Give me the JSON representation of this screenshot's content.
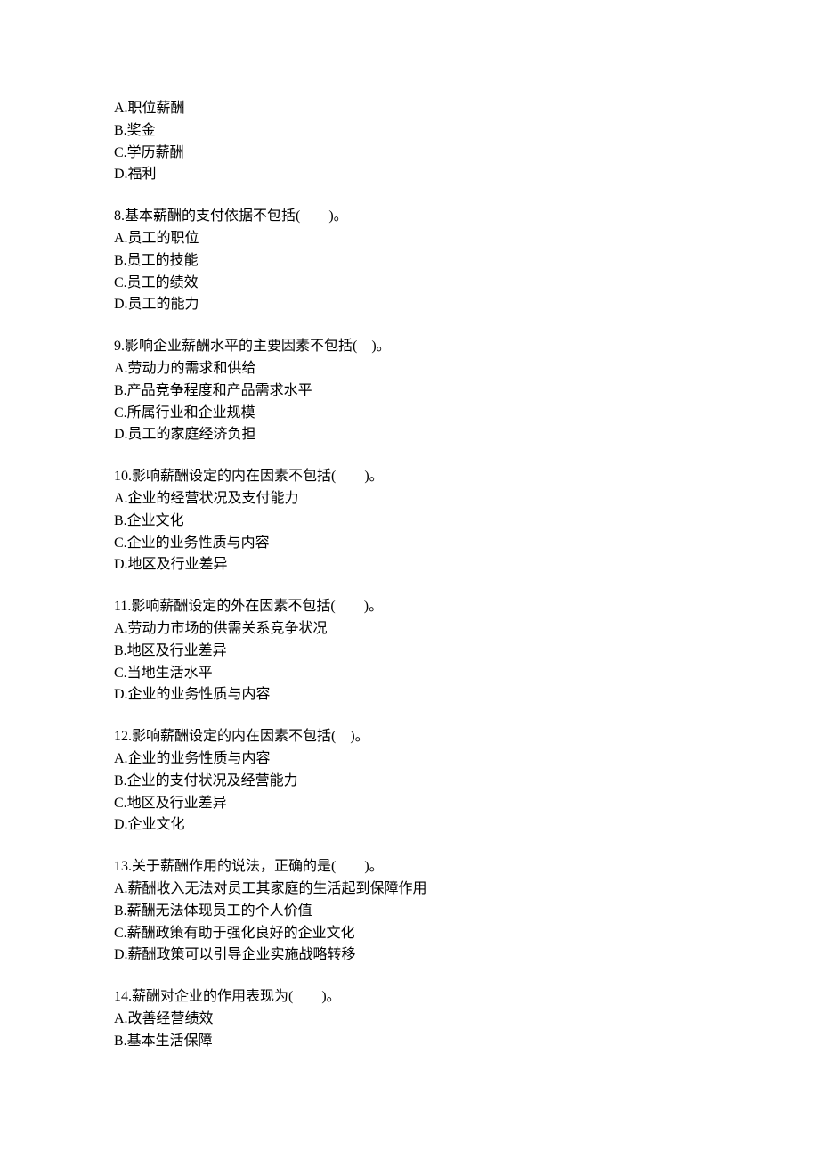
{
  "orphan_options": [
    "A.职位薪酬",
    "B.奖金",
    "C.学历薪酬",
    "D.福利"
  ],
  "questions": [
    {
      "stem": "8.基本薪酬的支付依据不包括(　　)。",
      "options": [
        "A.员工的职位",
        "B.员工的技能",
        "C.员工的绩效",
        "D.员工的能力"
      ]
    },
    {
      "stem": "9.影响企业薪酬水平的主要因素不包括(　)。",
      "options": [
        "A.劳动力的需求和供给",
        "B.产品竞争程度和产品需求水平",
        "C.所属行业和企业规模",
        "D.员工的家庭经济负担"
      ]
    },
    {
      "stem": "10.影响薪酬设定的内在因素不包括(　　)。",
      "options": [
        "A.企业的经营状况及支付能力",
        "B.企业文化",
        "C.企业的业务性质与内容",
        "D.地区及行业差异"
      ]
    },
    {
      "stem": "11.影响薪酬设定的外在因素不包括(　　)。",
      "options": [
        "A.劳动力市场的供需关系竞争状况",
        "B.地区及行业差异",
        "C.当地生活水平",
        "D.企业的业务性质与内容"
      ]
    },
    {
      "stem": "12.影响薪酬设定的内在因素不包括(　)。",
      "options": [
        "A.企业的业务性质与内容",
        "B.企业的支付状况及经营能力",
        "C.地区及行业差异",
        "D.企业文化"
      ]
    },
    {
      "stem": "13.关于薪酬作用的说法，正确的是(　　)。",
      "options": [
        "A.薪酬收入无法对员工其家庭的生活起到保障作用",
        "B.薪酬无法体现员工的个人价值",
        "C.薪酬政策有助于强化良好的企业文化",
        "D.薪酬政策可以引导企业实施战略转移"
      ]
    },
    {
      "stem": "14.薪酬对企业的作用表现为(　　)。",
      "options": [
        "A.改善经营绩效",
        "B.基本生活保障"
      ]
    }
  ]
}
